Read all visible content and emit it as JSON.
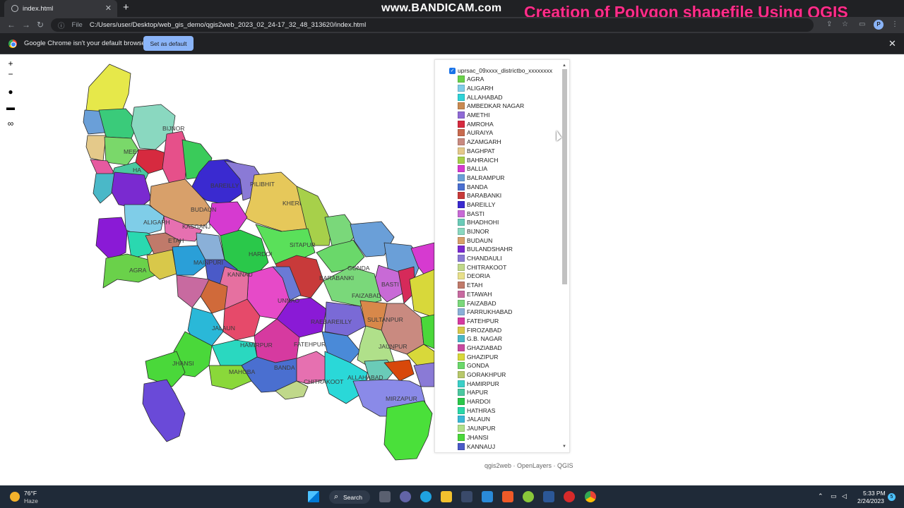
{
  "browser": {
    "tab_title": "index.html",
    "tab_close": "✕",
    "new_tab": "+",
    "scheme_label": "File",
    "url": "C:/Users/user/Desktop/web_gis_demo/qgis2web_2023_02_24-17_32_48_313620/index.html",
    "profile_initial": "P"
  },
  "overlay": {
    "watermark": "www.BANDICAM.com",
    "title": "Creation of Polygon shapefile Using QGIS"
  },
  "infobar": {
    "message": "Google Chrome isn't your default browser",
    "button": "Set as default",
    "close": "✕"
  },
  "map_controls": {
    "zoom_in": "+",
    "zoom_out": "−"
  },
  "map_labels": {
    "bijnor": "BIJNOR",
    "meerut": "MEE",
    "hapur": "HA",
    "bareilly": "BAREILLY",
    "pilibhit": "PILIBHIT",
    "kheri": "KHERI",
    "budaun": "BUDAUN",
    "aligarh": "ALIGARH",
    "kasganj": "KASGANJ",
    "etah": "ETAH",
    "hardoi": "HARDOI",
    "sitapur": "SITAPUR",
    "agra": "AGRA",
    "mainpuri": "MAINPURI",
    "kannauj": "KANNAU",
    "barabanki": "BARABANKI",
    "gonda": "GONDA",
    "basti": "BASTI",
    "faizabad": "FAIZABAD",
    "unnao": "UNNAO",
    "raebareilly": "RAEBAREILLY",
    "sultanpur": "SULTANPUR",
    "jalaun": "JALAUN",
    "hamirpur": "HAMIRPUR",
    "fatehpur": "FATEHPUR",
    "jaunpur": "JAUNPUR",
    "jhansi": "JHANSI",
    "mahoba": "MAHOBA",
    "banda": "BANDA",
    "chitrakoot": "CHITRAKOOT",
    "allahabad": "ALLAHABAD",
    "mirzapur": "MIRZAPUR"
  },
  "legend": {
    "layer_name": "uprsac_09xxxx_districtbo_xxxxxxxx",
    "items": [
      {
        "label": "AGRA",
        "color": "#6ad14a"
      },
      {
        "label": "ALIGARH",
        "color": "#7fcde8"
      },
      {
        "label": "ALLAHABAD",
        "color": "#2fd3d8"
      },
      {
        "label": "AMBEDKAR NAGAR",
        "color": "#c98a52"
      },
      {
        "label": "AMETHI",
        "color": "#8f6ad6"
      },
      {
        "label": "AMROHA",
        "color": "#d62a3f"
      },
      {
        "label": "AURAIYA",
        "color": "#c86a4e"
      },
      {
        "label": "AZAMGARH",
        "color": "#c98a80"
      },
      {
        "label": "BAGHPAT",
        "color": "#e4c98a"
      },
      {
        "label": "BAHRAICH",
        "color": "#a7d04a"
      },
      {
        "label": "BALLIA",
        "color": "#d63ad0"
      },
      {
        "label": "BALRAMPUR",
        "color": "#6a9fd8"
      },
      {
        "label": "BANDA",
        "color": "#4a6fd0"
      },
      {
        "label": "BARABANKI",
        "color": "#c83a3a"
      },
      {
        "label": "BAREILLY",
        "color": "#3a2ad0"
      },
      {
        "label": "BASTI",
        "color": "#c86ad6"
      },
      {
        "label": "BHADHOHI",
        "color": "#6acbb8"
      },
      {
        "label": "BIJNOR",
        "color": "#8ad8c0"
      },
      {
        "label": "BUDAUN",
        "color": "#d8a06a"
      },
      {
        "label": "BULANDSHAHR",
        "color": "#7a2ad0"
      },
      {
        "label": "CHANDAULI",
        "color": "#8a7ad6"
      },
      {
        "label": "CHITRAKOOT",
        "color": "#c0d88a"
      },
      {
        "label": "DEORIA",
        "color": "#e8e08a"
      },
      {
        "label": "ETAH",
        "color": "#c07a6a"
      },
      {
        "label": "ETAWAH",
        "color": "#c86aa0"
      },
      {
        "label": "FAIZABAD",
        "color": "#7ad87a"
      },
      {
        "label": "FARRUKHABAD",
        "color": "#8ab0d8"
      },
      {
        "label": "FATEHPUR",
        "color": "#d63aa0"
      },
      {
        "label": "FIROZABAD",
        "color": "#d8c84a"
      },
      {
        "label": "G.B. NAGAR",
        "color": "#4ab8c8"
      },
      {
        "label": "GHAZIABAD",
        "color": "#c84aa0"
      },
      {
        "label": "GHAZIPUR",
        "color": "#d8d83a"
      },
      {
        "label": "GONDA",
        "color": "#6ad86a"
      },
      {
        "label": "GORAKHPUR",
        "color": "#b8c86a"
      },
      {
        "label": "HAMIRPUR",
        "color": "#3ad0c8"
      },
      {
        "label": "HAPUR",
        "color": "#4ac8a0"
      },
      {
        "label": "HARDOI",
        "color": "#2ac84a"
      },
      {
        "label": "HATHRAS",
        "color": "#2ad8a8"
      },
      {
        "label": "JALAUN",
        "color": "#3ab8d8"
      },
      {
        "label": "JAUNPUR",
        "color": "#b0e08a"
      },
      {
        "label": "JHANSI",
        "color": "#4ad83a"
      },
      {
        "label": "KANNAUJ",
        "color": "#4a5ac8"
      }
    ]
  },
  "attribution": "qgis2web · OpenLayers · QGIS",
  "taskbar": {
    "temperature": "76°F",
    "weather": "Haze",
    "search": "Search",
    "time": "5:33 PM",
    "date": "2/24/2023",
    "notifications": "5"
  }
}
